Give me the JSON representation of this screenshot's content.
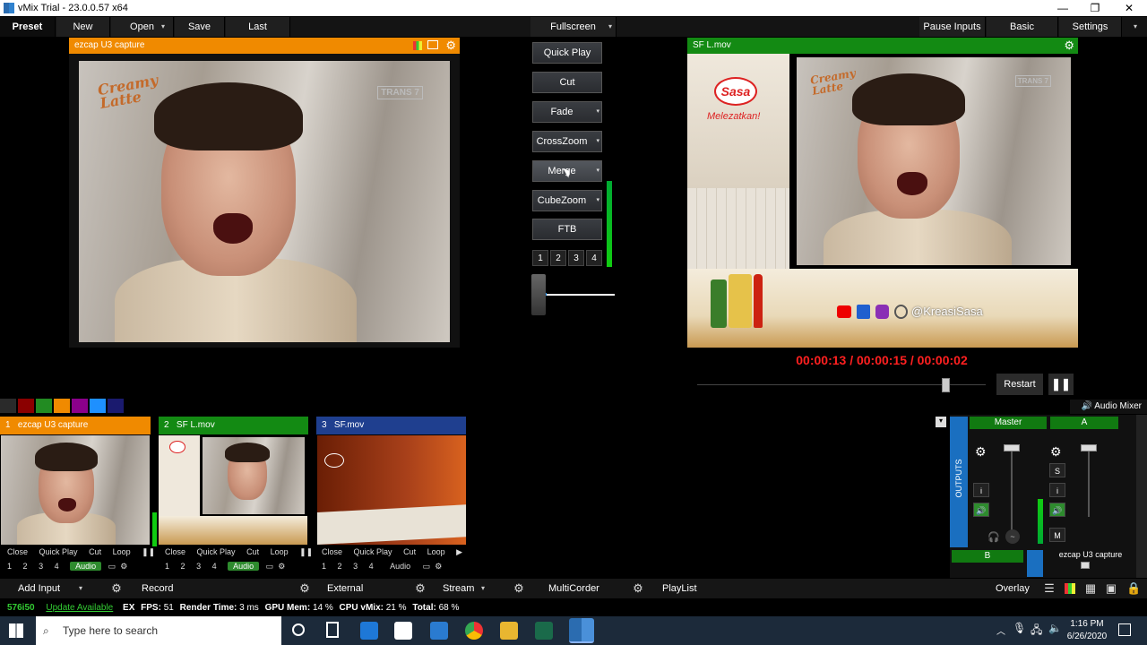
{
  "window": {
    "title": "vMix Trial - 23.0.0.57 x64",
    "controls": [
      "—",
      "❐",
      "✕"
    ]
  },
  "toolbar": {
    "preset": "Preset",
    "new": "New",
    "open": "Open",
    "save": "Save",
    "last": "Last",
    "fullscreen": "Fullscreen",
    "pause_inputs": "Pause Inputs",
    "basic": "Basic",
    "settings": "Settings"
  },
  "preview": {
    "title": "ezcap U3 capture",
    "header_color": "#f08a00",
    "watermark": "TRANS 7",
    "logo_text": "Creamy Latte"
  },
  "output": {
    "title": "SF L.mov",
    "header_color": "#138a13",
    "brand": "Sasa",
    "tagline": "Melezatkan!",
    "social_handle": "@KreasiSasa",
    "watermark": "TRANS 7",
    "logo_text": "Creamy Latte"
  },
  "transitions": {
    "quick_play": "Quick Play",
    "cut": "Cut",
    "fade": "Fade",
    "crosszoom": "CrossZoom",
    "merge": "Merge",
    "cubezoom": "CubeZoom",
    "ftb": "FTB",
    "numbers": [
      "1",
      "2",
      "3",
      "4"
    ]
  },
  "playback": {
    "timecode": "00:00:13 / 00:00:15 / 00:00:02",
    "restart": "Restart",
    "pause_icon": "pause-icon"
  },
  "colors": [
    "#8b0000",
    "#228b22",
    "#f08a00",
    "#8b008b",
    "#1e90ff",
    "#1a1a6e"
  ],
  "inputs": [
    {
      "num": "1",
      "name": "ezcap U3 capture",
      "color": "#f08a00",
      "controls": [
        "Close",
        "Quick Play",
        "Cut",
        "Loop"
      ],
      "numbers": [
        "1",
        "2",
        "3",
        "4"
      ],
      "audio": "Audio"
    },
    {
      "num": "2",
      "name": "SF L.mov",
      "color": "#138a13",
      "controls": [
        "Close",
        "Quick Play",
        "Cut",
        "Loop"
      ],
      "numbers": [
        "1",
        "2",
        "3",
        "4"
      ],
      "audio": "Audio"
    },
    {
      "num": "3",
      "name": "SF.mov",
      "color": "#1f3f8f",
      "controls": [
        "Close",
        "Quick Play",
        "Cut",
        "Loop"
      ],
      "numbers": [
        "1",
        "2",
        "3",
        "4"
      ],
      "audio": "Audio"
    }
  ],
  "mixer": {
    "title": "Audio Mixer",
    "outputs_label": "OUTPUTS",
    "master": "Master",
    "bus_a": "A",
    "bus_b": "B",
    "s": "S",
    "i": "i",
    "m": "M",
    "input_label": "ezcap U3 capture"
  },
  "bottom": {
    "add_input": "Add Input",
    "record": "Record",
    "external": "External",
    "stream": "Stream",
    "multicorder": "MultiCorder",
    "playlist": "PlayList",
    "overlay": "Overlay"
  },
  "status": {
    "resolution": "576i50",
    "update": "Update Available",
    "ex": "EX",
    "fps_label": "FPS:",
    "fps": "51",
    "render_label": "Render Time:",
    "render": "3 ms",
    "gpu_label": "GPU Mem:",
    "gpu": "14 %",
    "cpu_label": "CPU vMix:",
    "cpu": "21 %",
    "total_label": "Total:",
    "total": "68 %"
  },
  "taskbar": {
    "search_placeholder": "Type here to search",
    "time": "1:16 PM",
    "date": "6/26/2020"
  }
}
